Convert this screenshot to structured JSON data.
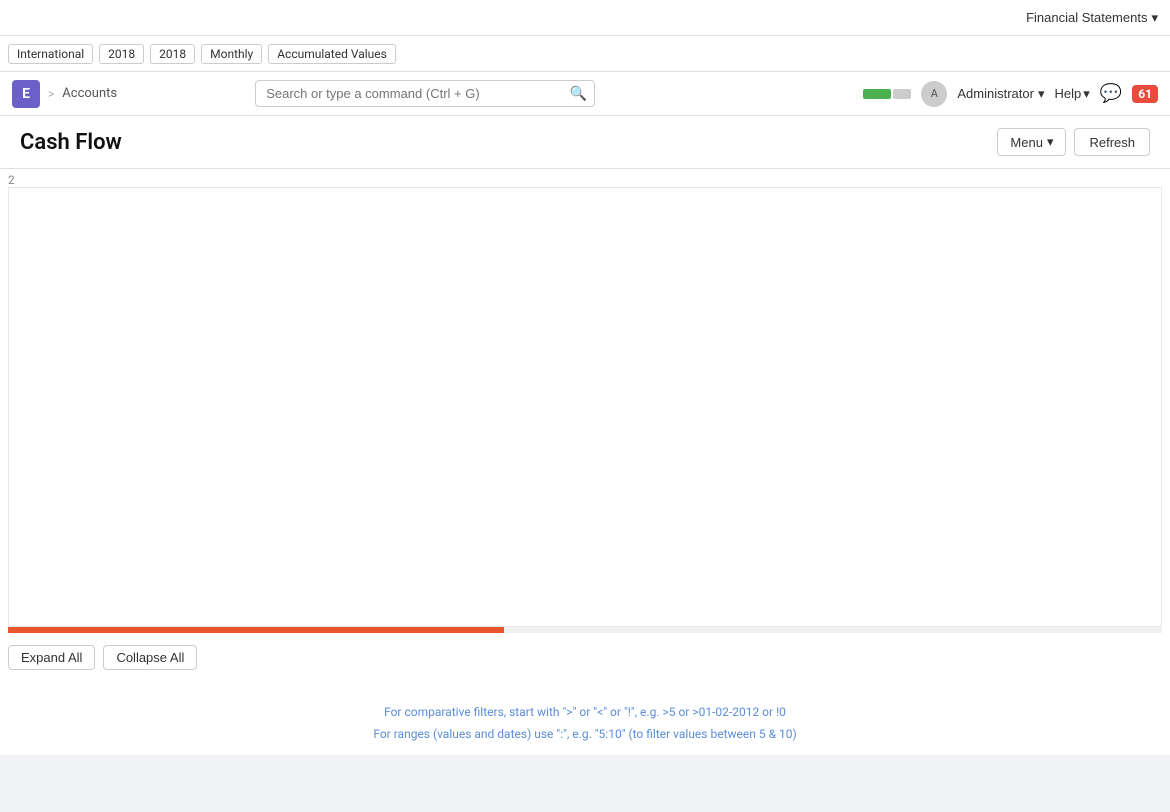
{
  "top_bar": {
    "financial_statements_label": "Financial Statements"
  },
  "filter_bar": {
    "filters": [
      {
        "label": "International"
      },
      {
        "label": "2018"
      },
      {
        "label": "2018"
      },
      {
        "label": "Monthly"
      },
      {
        "label": "Accumulated Values"
      }
    ]
  },
  "nav": {
    "app_letter": "E",
    "breadcrumb_separator": ">",
    "breadcrumb_item": "Accounts",
    "search_placeholder": "Search or type a command (Ctrl + G)",
    "admin_label": "Administrator",
    "help_label": "Help",
    "notification_count": "61"
  },
  "page": {
    "title": "Cash Flow",
    "menu_label": "Menu",
    "refresh_label": "Refresh"
  },
  "report": {
    "row_number": "2"
  },
  "actions": {
    "expand_all_label": "Expand All",
    "collapse_all_label": "Collapse All"
  },
  "helper": {
    "line1": "For comparative filters, start with \">\" or \"<\" or \"!\", e.g. >5 or >01-02-2012 or !0",
    "line2": "For ranges (values and dates) use \":\", e.g. \"5:10\" (to filter values between 5 & 10)"
  }
}
